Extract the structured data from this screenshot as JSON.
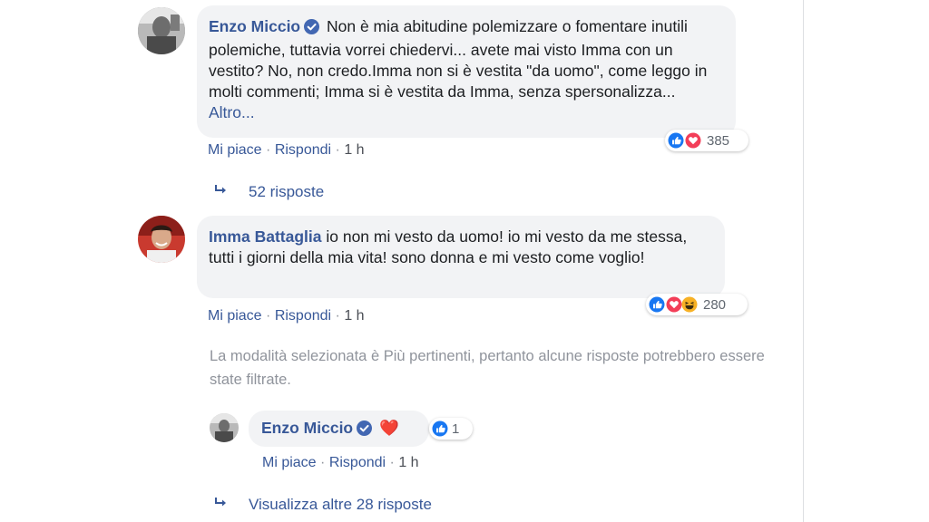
{
  "comments": [
    {
      "author": "Enzo Miccio",
      "text": "Non è mia abitudine polemizzare o fomentare inutili polemiche, tuttavia vorrei chiedervi... avete mai visto Imma con un vestito? No, non credo.Imma non si è vestita \"da uomo\", come leggo in molti commenti; Imma si è vestita da Imma, senza spersonalizza...",
      "more_label": "Altro...",
      "like_label": "Mi piace",
      "reply_label": "Rispondi",
      "time": "1 h",
      "reaction_count": "385",
      "reaction_icons": [
        "like-icon",
        "love-icon"
      ],
      "replies_label": "52 risposte"
    },
    {
      "author": "Imma Battaglia",
      "text": "io non mi vesto da uomo! io mi vesto da me stessa, tutti i giorni della mia vita! sono donna e mi vesto come voglio!",
      "like_label": "Mi piace",
      "reply_label": "Rispondi",
      "time": "1 h",
      "reaction_count": "280",
      "reaction_icons": [
        "like-icon",
        "love-icon",
        "haha-icon"
      ],
      "filter_notice": "La modalità selezionata è Più pertinenti, pertanto alcune risposte potrebbero essere state filtrate."
    }
  ],
  "reply": {
    "author": "Enzo Miccio",
    "text": "❤️",
    "like_label": "Mi piace",
    "reply_label": "Rispondi",
    "time": "1 h",
    "reaction_count": "1",
    "reaction_icons": [
      "like-icon"
    ]
  },
  "more_replies_label": "Visualizza altre 28 risposte",
  "separator": "·",
  "colors": {
    "link": "#385898",
    "bubble": "#f2f3f5",
    "meta": "#90949c",
    "like": "#1877f2",
    "love": "#f33e58",
    "haha": "#f7b125"
  }
}
